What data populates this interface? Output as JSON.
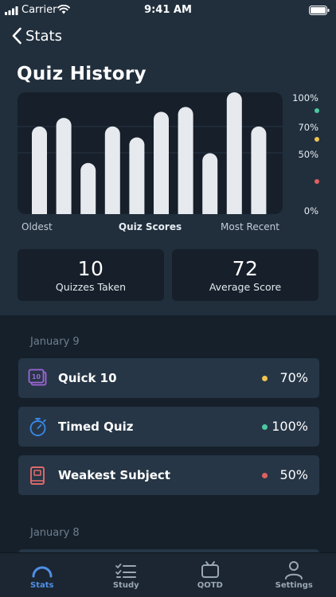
{
  "status_bar": {
    "carrier": "Carrier",
    "time": "9:41 AM"
  },
  "nav": {
    "back_label": "Stats"
  },
  "page": {
    "title": "Quiz History"
  },
  "chart_data": {
    "type": "bar",
    "categories": [
      "",
      "",
      "",
      "",
      "",
      "",
      "",
      "",
      "",
      ""
    ],
    "values": [
      72,
      79,
      42,
      72,
      63,
      84,
      88,
      50,
      100,
      72
    ],
    "ylim": [
      0,
      100
    ],
    "y_axis_labels": [
      "100%",
      "70%",
      "50%",
      "0%"
    ],
    "xlabel_left": "Oldest",
    "xlabel_center": "Quiz Scores",
    "xlabel_right": "Most Recent",
    "bar_color": "#e6e9ed",
    "threshold_colors": {
      "high": "#4cc9a0",
      "mid": "#f0c350",
      "low": "#e06060"
    }
  },
  "stats": {
    "quizzes_taken_value": "10",
    "quizzes_taken_label": "Quizzes Taken",
    "average_score_value": "72",
    "average_score_label": "Average Score"
  },
  "history": {
    "groups": [
      {
        "date": "January 9",
        "items": [
          {
            "name": "Quick 10",
            "score": "70%",
            "icon": "quick-10-icon",
            "dot_color": "#f0c350"
          },
          {
            "name": "Timed Quiz",
            "score": "100%",
            "icon": "stopwatch-icon",
            "dot_color": "#4cc9a0"
          },
          {
            "name": "Weakest Subject",
            "score": "50%",
            "icon": "book-icon",
            "dot_color": "#e06060"
          }
        ]
      },
      {
        "date": "January 8",
        "items": []
      }
    ]
  },
  "tab_bar": {
    "tabs": [
      {
        "label": "Stats",
        "icon": "stats-gauge-icon",
        "active": true
      },
      {
        "label": "Study",
        "icon": "checklist-icon",
        "active": false
      },
      {
        "label": "QOTD",
        "icon": "tv-icon",
        "active": false
      },
      {
        "label": "Settings",
        "icon": "person-icon",
        "active": false
      }
    ]
  },
  "colors": {
    "accent": "#4f8fe8",
    "background": "#16202b",
    "header_background": "#212f3d",
    "card": "#263646"
  }
}
